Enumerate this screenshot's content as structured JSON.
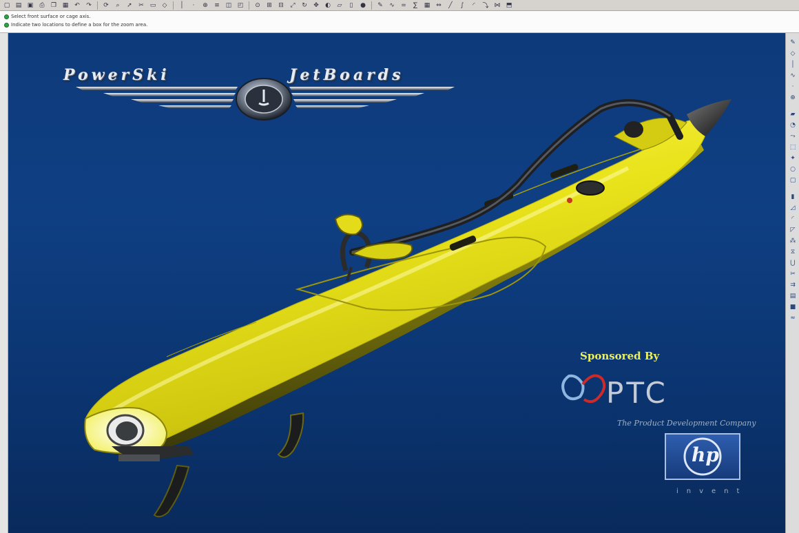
{
  "toolbar": {
    "icons": [
      "new-file-icon",
      "open-folder-icon",
      "save-icon",
      "print-icon",
      "copy-icon",
      "paste-icon",
      "undo-icon",
      "redo-icon",
      "regenerate-icon",
      "find-icon",
      "select-icon",
      "cut-icon",
      "window-icon",
      "datum-plane-icon",
      "datum-axis-icon",
      "datum-point-icon",
      "coordinate-system-icon",
      "layer-icon",
      "view-manager-icon",
      "saved-views-icon",
      "orient-icon",
      "zoom-in-icon",
      "zoom-out-icon",
      "refit-icon",
      "repaint-icon",
      "spin-center-icon",
      "display-style-icon",
      "wireframe-icon",
      "hidden-line-icon",
      "shading-icon",
      "sketch-icon",
      "analysis-icon",
      "relations-icon",
      "parameters-icon",
      "family-table-icon",
      "measure-icon",
      "sketch-line-icon",
      "curve-icon",
      "round-icon",
      "sweep-icon",
      "blend-icon",
      "extrude-icon"
    ]
  },
  "messages": [
    "Select front surface or cage axis.",
    "Indicate two locations to define a box for the zoom area."
  ],
  "graphics": {
    "brand_logo_text_left": "PowerSki",
    "brand_logo_text_right": "JetBoards",
    "sponsor_label": "Sponsored By",
    "ptc_wordmark": "PTC",
    "ptc_tagline": "The Product Development Company",
    "hp_wordmark": "hp",
    "hp_tagline": "invent"
  },
  "right_toolbar": {
    "icons": [
      "sketch-tool-icon",
      "datum-plane-tool-icon",
      "axis-tool-icon",
      "curve-tool-icon",
      "point-tool-icon",
      "csys-tool-icon",
      "extrude-tool-icon",
      "revolve-tool-icon",
      "variable-section-sweep-icon",
      "boundary-blend-icon",
      "style-tool-icon",
      "hole-tool-icon",
      "shell-tool-icon",
      "rib-tool-icon",
      "draft-tool-icon",
      "round-tool-icon",
      "chamfer-tool-icon",
      "pattern-tool-icon",
      "mirror-tool-icon",
      "merge-tool-icon",
      "trim-tool-icon",
      "offset-tool-icon",
      "thicken-tool-icon",
      "solidify-tool-icon",
      "warp-tool-icon"
    ]
  },
  "colors": {
    "viewport_top": "#0d3a7a",
    "viewport_bottom": "#092a5c",
    "board_yellow": "#e8e21a",
    "board_shadow": "#6b6a10",
    "sponsor_text": "#e9ef64"
  }
}
